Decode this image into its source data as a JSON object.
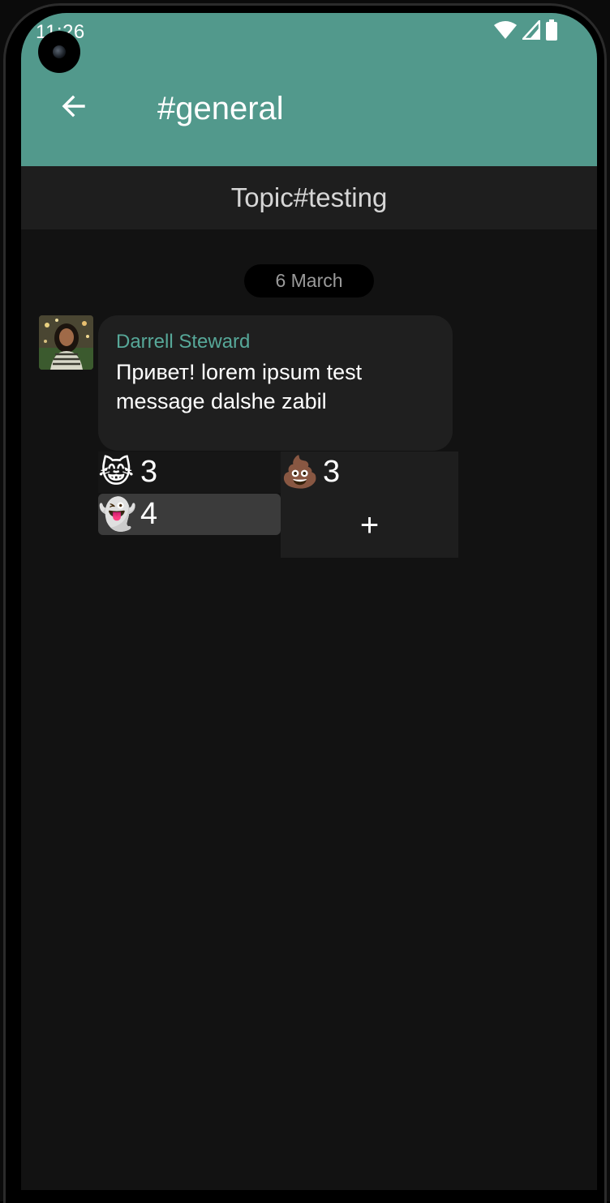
{
  "status_bar": {
    "time": "11:26",
    "icons": [
      "wifi-icon",
      "signal-icon",
      "battery-icon"
    ]
  },
  "app_bar": {
    "back_icon": "arrow-left-icon",
    "title": "#general",
    "color": "#52998c"
  },
  "topic": {
    "label": "Topic#testing"
  },
  "messages": [
    {
      "date_label": "6 March",
      "sender": "Darrell Steward",
      "text": "Привет! lorem ipsum test message dalshe zabil",
      "reactions": [
        {
          "emoji": "😹",
          "count": "3"
        },
        {
          "emoji": "💩",
          "count": "3"
        },
        {
          "emoji": "👻",
          "count": "4"
        }
      ],
      "add_reaction_label": "+"
    }
  ],
  "colors": {
    "accent": "#52998c",
    "sender_name": "#57a899",
    "background": "#121212",
    "bubble": "#1f1f1f"
  }
}
